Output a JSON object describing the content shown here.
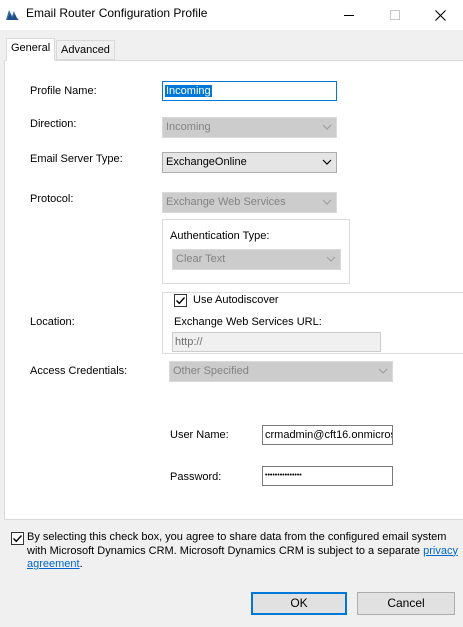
{
  "window": {
    "title": "Email Router Configuration Profile",
    "controls": [
      "minimize",
      "maximize",
      "close"
    ]
  },
  "tabs": [
    {
      "label": "General",
      "active": true
    },
    {
      "label": "Advanced",
      "active": false
    }
  ],
  "form": {
    "profile_name": {
      "label": "Profile Name:",
      "value": "Incoming"
    },
    "direction": {
      "label": "Direction:",
      "value": "Incoming",
      "enabled": false
    },
    "email_server_type": {
      "label": "Email Server Type:",
      "value": "ExchangeOnline",
      "enabled": true
    },
    "protocol": {
      "label": "Protocol:",
      "value": "Exchange Web Services",
      "enabled": false
    },
    "authentication_type": {
      "label": "Authentication Type:",
      "value": "Clear Text",
      "enabled": false
    },
    "location": {
      "label": "Location:",
      "use_autodiscover": {
        "label": "Use Autodiscover",
        "checked": true
      },
      "ews_url": {
        "label": "Exchange Web Services URL:",
        "placeholder": "http://"
      }
    },
    "access_credentials": {
      "label": "Access Credentials:",
      "value": "Other Specified",
      "enabled": false
    },
    "user_name": {
      "label": "User Name:",
      "value": "crmadmin@cft16.onmicros"
    },
    "password": {
      "label": "Password:",
      "value": "•••••••••••••••"
    }
  },
  "consent": {
    "checked": true,
    "text_line1": "By selecting this check box, you agree to share data from the configured email system",
    "text_line2_prefix": "with Microsoft Dynamics CRM. Microsoft Dynamics CRM is subject to a separate ",
    "link_part1": "privacy",
    "link_part2": "agreement",
    "text_suffix": "."
  },
  "buttons": {
    "ok": "OK",
    "cancel": "Cancel"
  },
  "colors": {
    "accent": "#0078d7",
    "link": "#0066cc",
    "window_bg": "#f0f0f0"
  }
}
